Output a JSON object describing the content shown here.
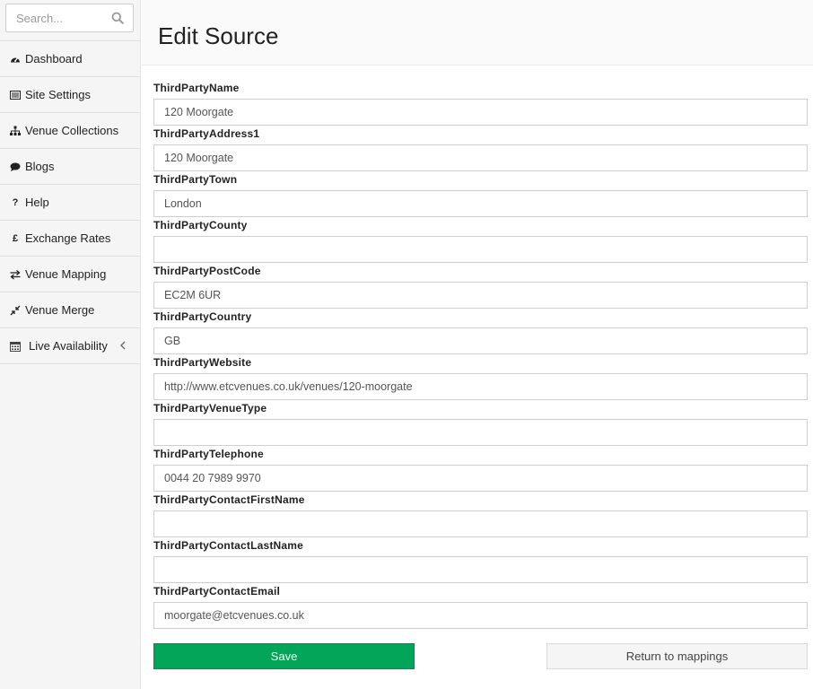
{
  "sidebar": {
    "search_placeholder": "Search...",
    "items": [
      {
        "label": "Dashboard",
        "icon": "dashboard-icon"
      },
      {
        "label": "Site Settings",
        "icon": "list-icon"
      },
      {
        "label": "Venue Collections",
        "icon": "sitemap-icon"
      },
      {
        "label": "Blogs",
        "icon": "comment-icon"
      },
      {
        "label": "Help",
        "icon": "question-icon"
      },
      {
        "label": "Exchange Rates",
        "icon": "pound-icon"
      },
      {
        "label": "Venue Mapping",
        "icon": "exchange-icon"
      },
      {
        "label": "Venue Merge",
        "icon": "compress-icon"
      },
      {
        "label": "Live Availability",
        "icon": "calendar-icon"
      }
    ]
  },
  "page": {
    "title": "Edit Source"
  },
  "form": {
    "fields": [
      {
        "label": "ThirdPartyName",
        "value": "120 Moorgate"
      },
      {
        "label": "ThirdPartyAddress1",
        "value": "120 Moorgate"
      },
      {
        "label": "ThirdPartyTown",
        "value": "London"
      },
      {
        "label": "ThirdPartyCounty",
        "value": ""
      },
      {
        "label": "ThirdPartyPostCode",
        "value": "EC2M 6UR"
      },
      {
        "label": "ThirdPartyCountry",
        "value": "GB"
      },
      {
        "label": "ThirdPartyWebsite",
        "value": "http://www.etcvenues.co.uk/venues/120-moorgate"
      },
      {
        "label": "ThirdPartyVenueType",
        "value": ""
      },
      {
        "label": "ThirdPartyTelephone",
        "value": "0044 20 7989 9970"
      },
      {
        "label": "ThirdPartyContactFirstName",
        "value": ""
      },
      {
        "label": "ThirdPartyContactLastName",
        "value": ""
      },
      {
        "label": "ThirdPartyContactEmail",
        "value": "moorgate@etcvenues.co.uk"
      }
    ],
    "save_label": "Save",
    "return_label": "Return to mappings"
  },
  "colors": {
    "save_button": "#03a658",
    "sidebar_bg": "#f5f5f5"
  }
}
